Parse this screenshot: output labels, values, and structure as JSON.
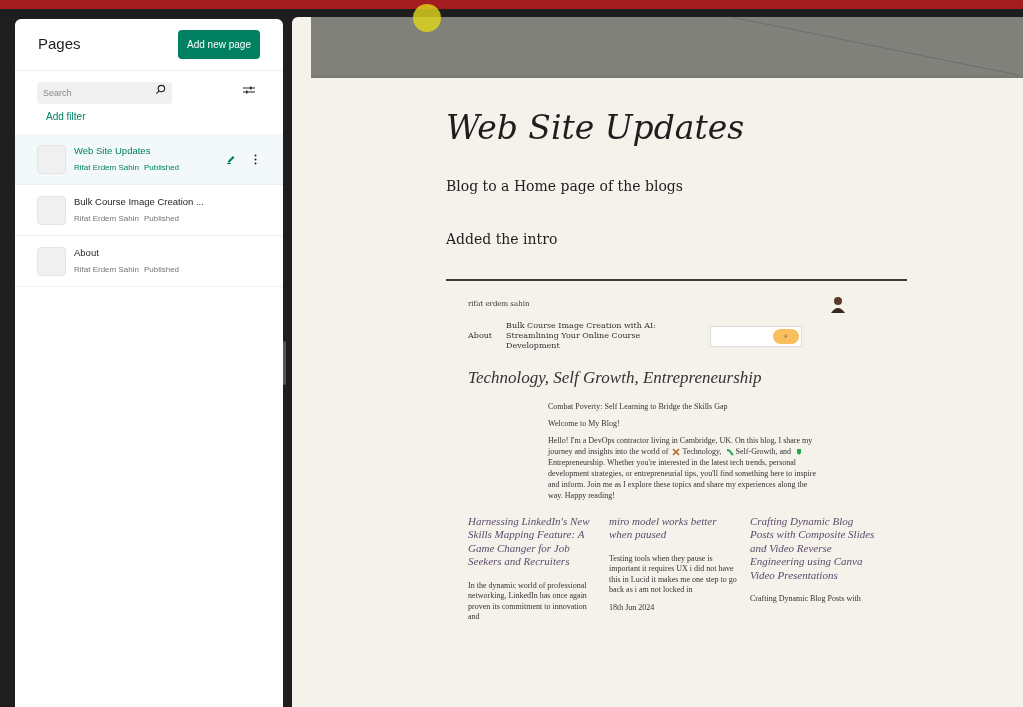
{
  "sidebar": {
    "title": "Pages",
    "add_button": "Add new page",
    "search": {
      "placeholder": "Search"
    },
    "add_filter": "Add filter",
    "pages": [
      {
        "title": "Web Site Updates",
        "author": "Rifat Erdem Sahin",
        "status": "Published",
        "selected": true
      },
      {
        "title": "Bulk Course Image Creation ...",
        "author": "Rifat Erdem Sahin",
        "status": "Published",
        "selected": false
      },
      {
        "title": "About",
        "author": "Rifat Erdem Sahin",
        "status": "Published",
        "selected": false
      }
    ]
  },
  "editor": {
    "title": "Web Site Updates",
    "paragraphs": [
      "Blog to a Home page of the blogs",
      "Added the intro"
    ],
    "preview": {
      "site_name": "rifat erdem sahin",
      "nav": [
        "About",
        "Bulk Course Image Creation with AI: Streamlining Your Online Course Development"
      ],
      "search_button": "⌕",
      "tagline": "Technology, Self Growth, Entrepreneurship",
      "intro": [
        "Combat Poverty: Self Learning to Bridge the Skills Gap",
        "Welcome to My Blog!"
      ],
      "body_parts": [
        "Hello! I'm a DevOps contractor living in Cambridge, UK. On this blog, I share my journey and insights into the world of",
        "Technology,",
        "Self-Growth, and",
        "Entrepreneurship. Whether you're interested in the latest tech trends, personal development strategies, or entrepreneurial tips, you'll find something here to inspire and inform. Join me as I explore these topics and share my experiences along the way. Happy reading!"
      ],
      "posts": [
        {
          "title": "Harnessing LinkedIn's New Skills Mapping Feature: A Game Changer for Job Seekers and Recruiters",
          "excerpt": "In the dynamic world of professional networking, LinkedIn has once again proven its commitment to innovation and"
        },
        {
          "title": "miro model works better when paused",
          "excerpt": "Testing tools when they pause is important it requires UX i did not have this in Lucid it makes me one step to go back as i am not locked in",
          "date": "18th Jun 2024"
        },
        {
          "title": "Crafting Dynamic Blog Posts with Composite Slides and Video Reverse Engineering using Canva\nVideo Presentations",
          "excerpt": "Crafting Dynamic Blog Posts with"
        }
      ]
    }
  }
}
